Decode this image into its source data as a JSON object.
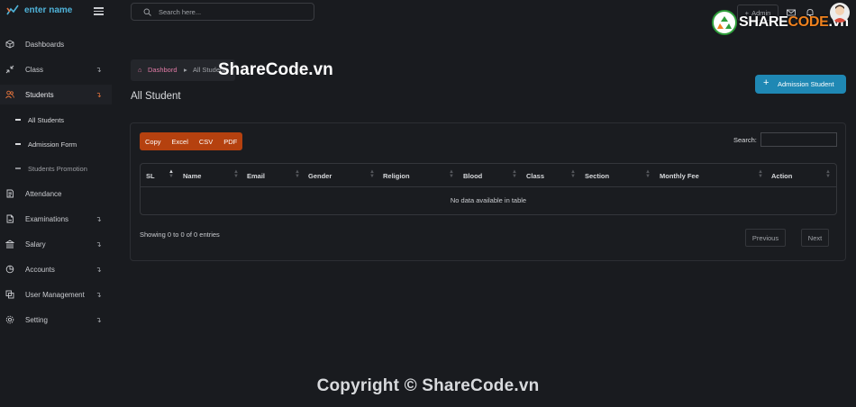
{
  "brand": {
    "name": "enter name"
  },
  "sidebar": {
    "items": [
      {
        "label": "Dashboards",
        "icon": "cube-icon",
        "chevron": ""
      },
      {
        "label": "Class",
        "icon": "arrows-icon",
        "chevron": "↴"
      },
      {
        "label": "Students",
        "icon": "users-icon",
        "chevron": "↴"
      },
      {
        "label": "Attendance",
        "icon": "document-icon",
        "chevron": ""
      },
      {
        "label": "Examinations",
        "icon": "file-icon",
        "chevron": "↴"
      },
      {
        "label": "Salary",
        "icon": "bank-icon",
        "chevron": "↴"
      },
      {
        "label": "Accounts",
        "icon": "pie-chart-icon",
        "chevron": "↴"
      },
      {
        "label": "User Management",
        "icon": "copy-icon",
        "chevron": "↴"
      },
      {
        "label": "Setting",
        "icon": "gear-icon",
        "chevron": "↴"
      }
    ],
    "sub_items": [
      {
        "label": "All Students"
      },
      {
        "label": "Admission Form"
      },
      {
        "label": "Students Promotion"
      }
    ]
  },
  "header": {
    "search_placeholder": "Search here...",
    "admin_label": "Admin",
    "watermark_share": "SHARE",
    "watermark_code": "CODE",
    "watermark_domain": ".vn"
  },
  "breadcrumb": {
    "home": "Dashbord",
    "current": "All Student"
  },
  "page": {
    "title": "All Student",
    "action_button": "Admission Student"
  },
  "table_controls": {
    "export_buttons": [
      "Copy",
      "Excel",
      "CSV",
      "PDF"
    ],
    "search_label": "Search:"
  },
  "table": {
    "columns": [
      "SL",
      "Name",
      "Email",
      "Gender",
      "Religion",
      "Blood",
      "Class",
      "Section",
      "Monthly Fee",
      "Action"
    ],
    "empty_message": "No data available in table",
    "info": "Showing 0 to 0 of 0 entries",
    "prev_label": "Previous",
    "next_label": "Next"
  },
  "watermark": {
    "center": "ShareCode.vn",
    "copyright": "Copyright © ShareCode.vn"
  },
  "colors": {
    "accent_blue": "#1f88b4",
    "export_orange": "#b5410f",
    "brand_blue": "#4fb3d9",
    "breadcrumb_pink": "#e07aa5"
  }
}
